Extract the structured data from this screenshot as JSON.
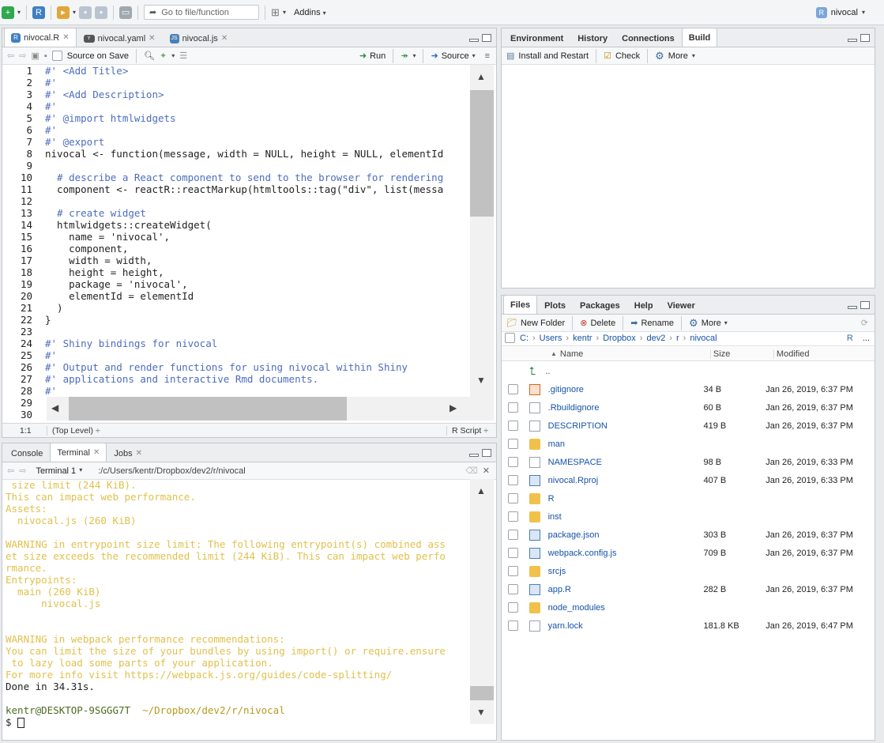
{
  "toolbar": {
    "goto_placeholder": "Go to file/function",
    "addins_label": "Addins",
    "project_label": "nivocal"
  },
  "editor": {
    "tabs": [
      {
        "label": "nivocal.R",
        "active": true
      },
      {
        "label": "nivocal.yaml",
        "active": false
      },
      {
        "label": "nivocal.js",
        "active": false
      }
    ],
    "source_on_save": "Source on Save",
    "run_label": "Run",
    "source_label": "Source",
    "status": {
      "position": "1:1",
      "scope": "(Top Level) ÷",
      "filetype": "R Script ÷"
    },
    "lines": [
      {
        "n": "1",
        "t": "#' <Add Title>",
        "c": "cm"
      },
      {
        "n": "2",
        "t": "#'",
        "c": "cm"
      },
      {
        "n": "3",
        "t": "#' <Add Description>",
        "c": "cm"
      },
      {
        "n": "4",
        "t": "#'",
        "c": "cm"
      },
      {
        "n": "5",
        "t": "#' @import htmlwidgets",
        "c": "cm"
      },
      {
        "n": "6",
        "t": "#'",
        "c": "cm"
      },
      {
        "n": "7",
        "t": "#' @export",
        "c": "cm"
      },
      {
        "n": "8",
        "t": "nivocal <- function(message, width = NULL, height = NULL, elementId",
        "c": "fn"
      },
      {
        "n": "9",
        "t": "",
        "c": "fn"
      },
      {
        "n": "10",
        "t": "  # describe a React component to send to the browser for rendering",
        "c": "cm"
      },
      {
        "n": "11",
        "t": "  component <- reactR::reactMarkup(htmltools::tag(\"div\", list(messa",
        "c": "fn"
      },
      {
        "n": "12",
        "t": "",
        "c": "fn"
      },
      {
        "n": "13",
        "t": "  # create widget",
        "c": "cm"
      },
      {
        "n": "14",
        "t": "  htmlwidgets::createWidget(",
        "c": "fn"
      },
      {
        "n": "15",
        "t": "    name = 'nivocal',",
        "c": "fn"
      },
      {
        "n": "16",
        "t": "    component,",
        "c": "fn"
      },
      {
        "n": "17",
        "t": "    width = width,",
        "c": "fn"
      },
      {
        "n": "18",
        "t": "    height = height,",
        "c": "fn"
      },
      {
        "n": "19",
        "t": "    package = 'nivocal',",
        "c": "fn"
      },
      {
        "n": "20",
        "t": "    elementId = elementId",
        "c": "fn"
      },
      {
        "n": "21",
        "t": "  )",
        "c": "fn"
      },
      {
        "n": "22",
        "t": "}",
        "c": "fn"
      },
      {
        "n": "23",
        "t": "",
        "c": "fn"
      },
      {
        "n": "24",
        "t": "#' Shiny bindings for nivocal",
        "c": "cm"
      },
      {
        "n": "25",
        "t": "#'",
        "c": "cm"
      },
      {
        "n": "26",
        "t": "#' Output and render functions for using nivocal within Shiny",
        "c": "cm"
      },
      {
        "n": "27",
        "t": "#' applications and interactive Rmd documents.",
        "c": "cm"
      },
      {
        "n": "28",
        "t": "#'",
        "c": "cm"
      },
      {
        "n": "29",
        "t": "",
        "c": "fn"
      },
      {
        "n": "30",
        "t": "",
        "c": "fn"
      }
    ]
  },
  "console": {
    "tabs": [
      {
        "label": "Console"
      },
      {
        "label": "Terminal"
      },
      {
        "label": "Jobs"
      }
    ],
    "terminal_select": "Terminal 1",
    "path": ":/c/Users/kentr/Dropbox/dev2/r/nivocal",
    "lines": [
      {
        "t": " size limit (244 KiB).",
        "c": "cons"
      },
      {
        "t": "This can impact web performance.",
        "c": "cons"
      },
      {
        "t": "Assets:",
        "c": "cons"
      },
      {
        "t": "  nivocal.js (260 KiB)",
        "c": "cons"
      },
      {
        "t": "",
        "c": "cons"
      },
      {
        "t": "WARNING in entrypoint size limit: The following entrypoint(s) combined ass",
        "c": "cons"
      },
      {
        "t": "et size exceeds the recommended limit (244 KiB). This can impact web perfo",
        "c": "cons"
      },
      {
        "t": "rmance.",
        "c": "cons"
      },
      {
        "t": "Entrypoints:",
        "c": "cons"
      },
      {
        "t": "  main (260 KiB)",
        "c": "cons"
      },
      {
        "t": "      nivocal.js",
        "c": "cons"
      },
      {
        "t": "",
        "c": "cons"
      },
      {
        "t": "",
        "c": "cons"
      },
      {
        "t": "WARNING in webpack performance recommendations:",
        "c": "cons"
      },
      {
        "t": "You can limit the size of your bundles by using import() or require.ensure",
        "c": "cons"
      },
      {
        "t": " to lazy load some parts of your application.",
        "c": "cons"
      },
      {
        "t": "For more info visit https://webpack.js.org/guides/code-splitting/",
        "c": "cons"
      },
      {
        "t": "Done in 34.31s.",
        "c": "plain"
      },
      {
        "t": "",
        "c": "plain"
      }
    ],
    "prompt_user": "kentr@DESKTOP-9SGGG7T",
    "prompt_path": "~/Dropbox/dev2/r/nivocal",
    "prompt_symbol": "$"
  },
  "env": {
    "tabs": [
      {
        "label": "Environment"
      },
      {
        "label": "History"
      },
      {
        "label": "Connections"
      },
      {
        "label": "Build"
      }
    ],
    "install_label": "Install and Restart",
    "check_label": "Check",
    "more_label": "More"
  },
  "files": {
    "tabs": [
      {
        "label": "Files"
      },
      {
        "label": "Plots"
      },
      {
        "label": "Packages"
      },
      {
        "label": "Help"
      },
      {
        "label": "Viewer"
      }
    ],
    "new_folder": "New Folder",
    "delete": "Delete",
    "rename": "Rename",
    "more": "More",
    "crumbs": [
      "C:",
      "Users",
      "kentr",
      "Dropbox",
      "dev2",
      "r",
      "nivocal"
    ],
    "ellipsis": "...",
    "headers": {
      "name": "Name",
      "size": "Size",
      "modified": "Modified"
    },
    "parent": "..",
    "rows": [
      {
        "name": ".gitignore",
        "size": "34 B",
        "modified": "Jan 26, 2019, 6:37 PM",
        "icon": "git-file-icon"
      },
      {
        "name": ".Rbuildignore",
        "size": "60 B",
        "modified": "Jan 26, 2019, 6:37 PM",
        "icon": "text-file-icon"
      },
      {
        "name": "DESCRIPTION",
        "size": "419 B",
        "modified": "Jan 26, 2019, 6:37 PM",
        "icon": "description-file-icon"
      },
      {
        "name": "man",
        "size": "",
        "modified": "",
        "icon": "folder-icon"
      },
      {
        "name": "NAMESPACE",
        "size": "98 B",
        "modified": "Jan 26, 2019, 6:33 PM",
        "icon": "text-file-icon"
      },
      {
        "name": "nivocal.Rproj",
        "size": "407 B",
        "modified": "Jan 26, 2019, 6:33 PM",
        "icon": "rproj-file-icon"
      },
      {
        "name": "R",
        "size": "",
        "modified": "",
        "icon": "folder-icon"
      },
      {
        "name": "inst",
        "size": "",
        "modified": "",
        "icon": "folder-icon"
      },
      {
        "name": "package.json",
        "size": "303 B",
        "modified": "Jan 26, 2019, 6:37 PM",
        "icon": "json-file-icon"
      },
      {
        "name": "webpack.config.js",
        "size": "709 B",
        "modified": "Jan 26, 2019, 6:37 PM",
        "icon": "js-file-icon"
      },
      {
        "name": "srcjs",
        "size": "",
        "modified": "",
        "icon": "folder-icon"
      },
      {
        "name": "app.R",
        "size": "282 B",
        "modified": "Jan 26, 2019, 6:37 PM",
        "icon": "r-file-icon"
      },
      {
        "name": "node_modules",
        "size": "",
        "modified": "",
        "icon": "folder-icon"
      },
      {
        "name": "yarn.lock",
        "size": "181.8 KB",
        "modified": "Jan 26, 2019, 6:47 PM",
        "icon": "text-file-icon"
      }
    ]
  },
  "colors": {
    "console_text": "#e0c14d",
    "comment": "#4d6dbe",
    "link": "#1652a8"
  }
}
